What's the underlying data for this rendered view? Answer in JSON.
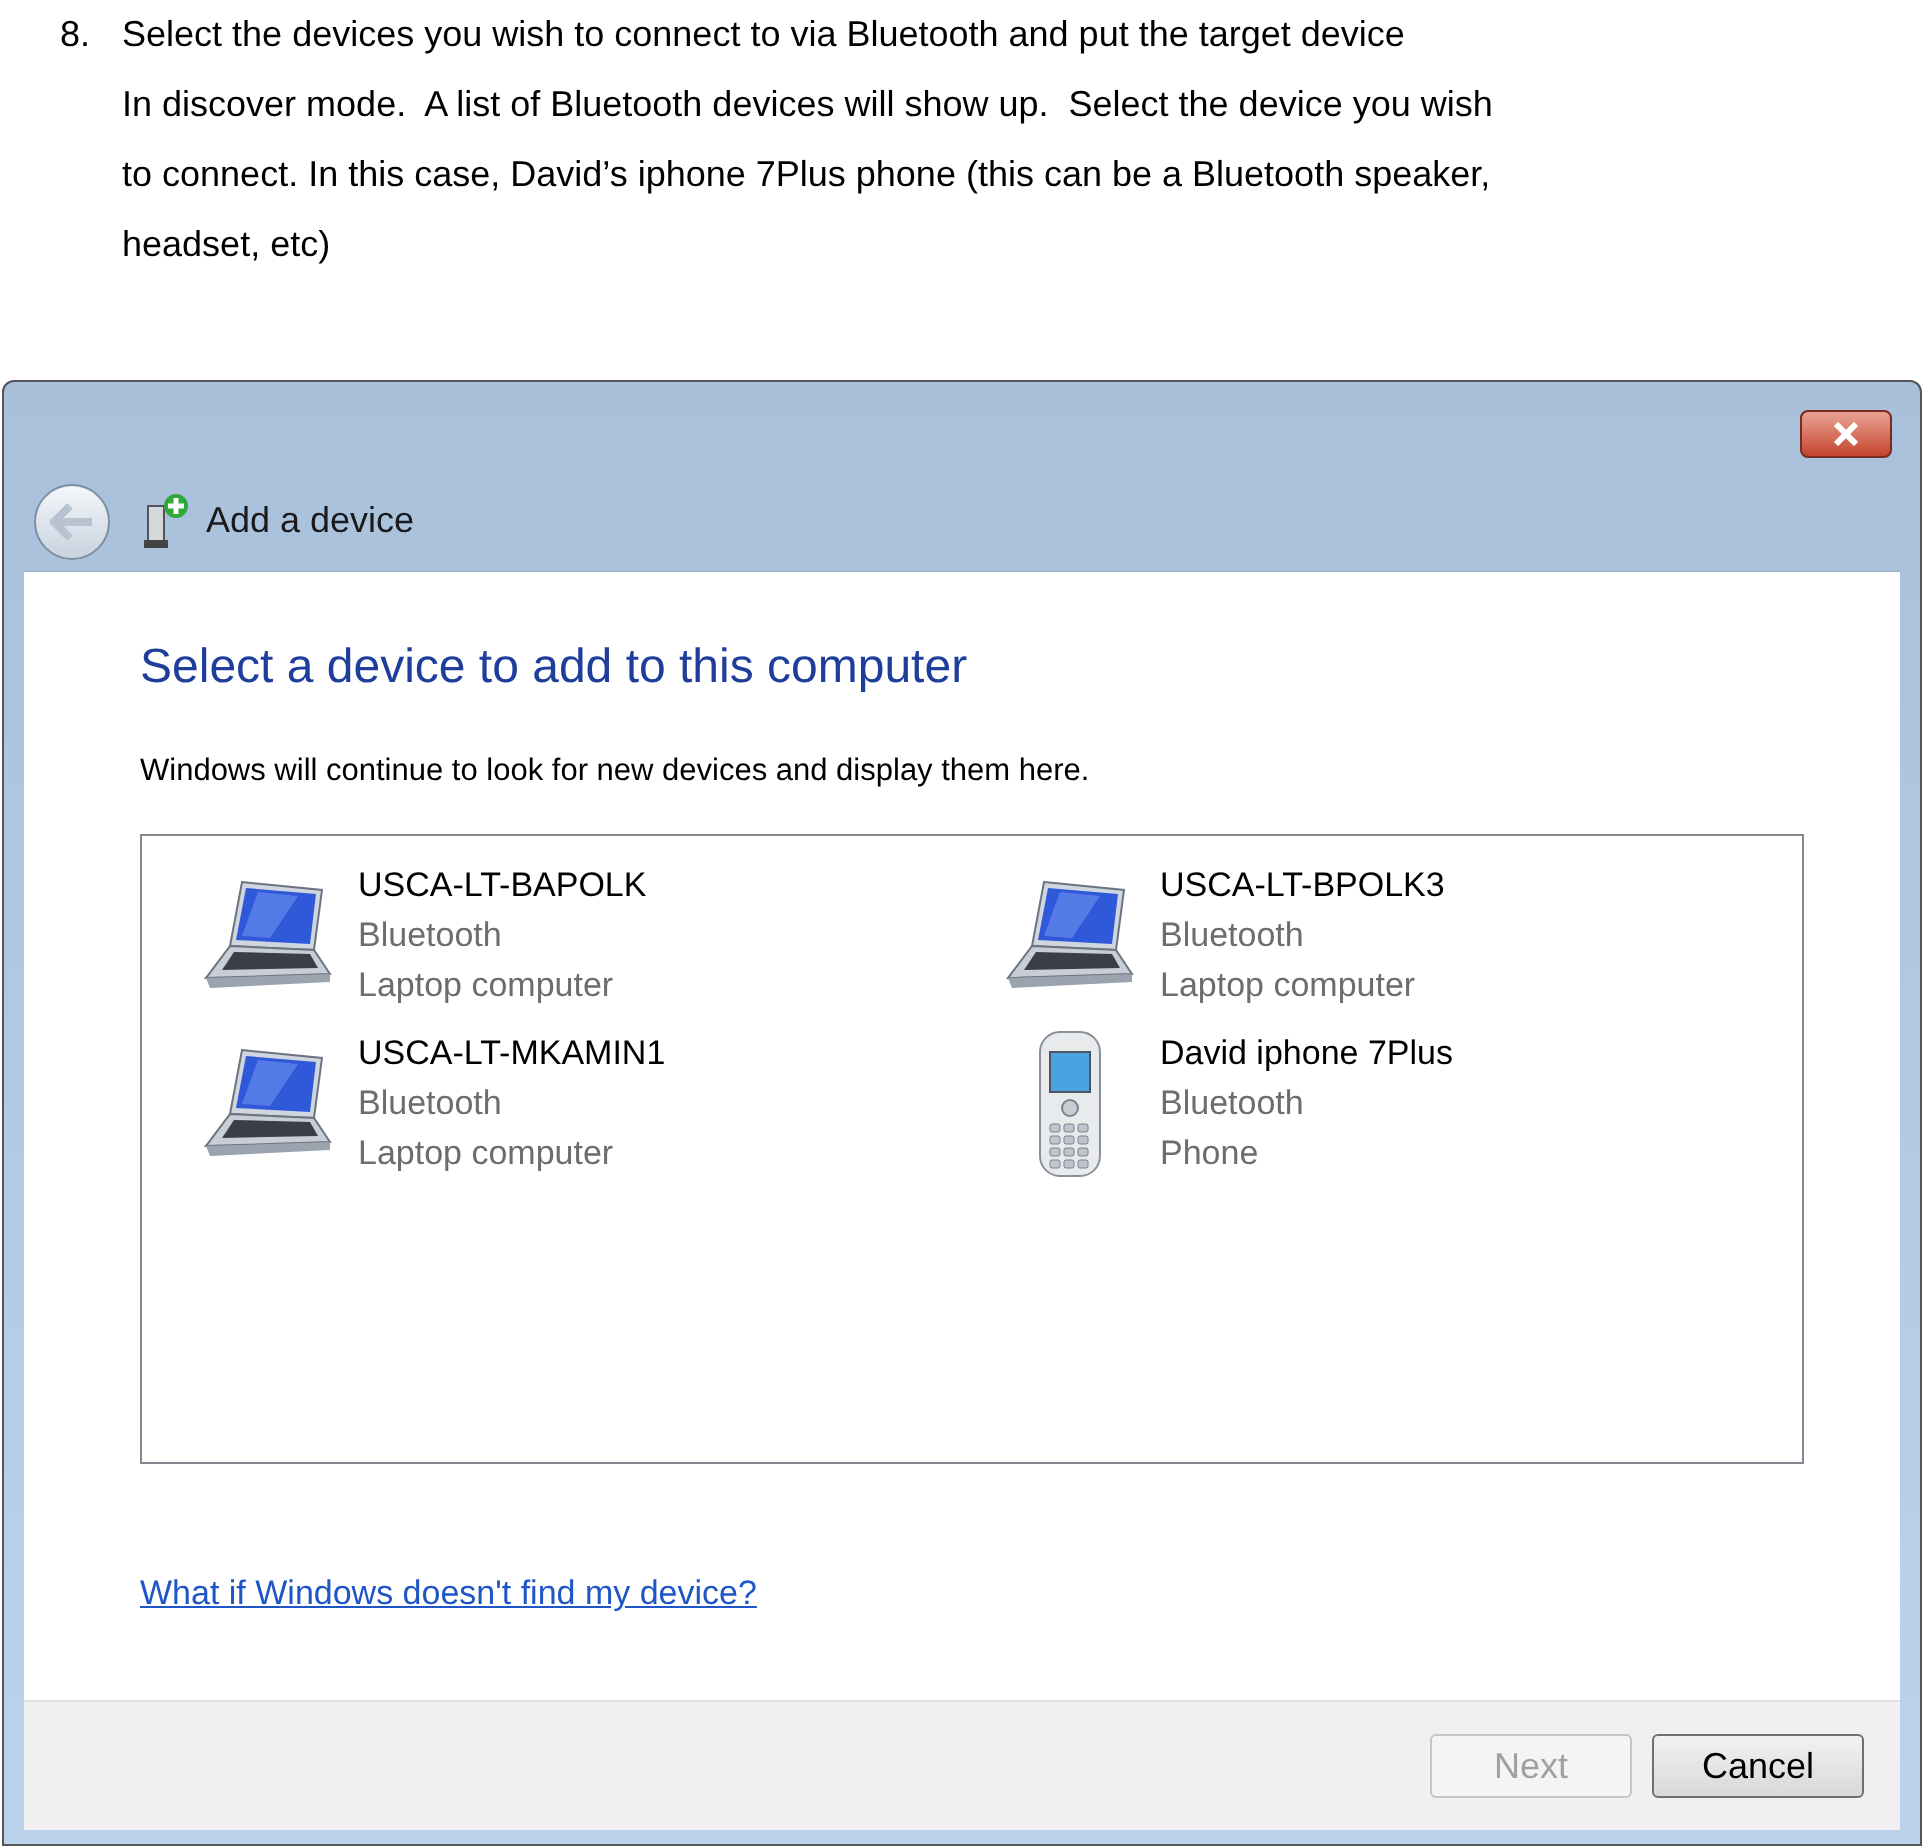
{
  "instruction": {
    "number": "8.",
    "lines": [
      "Select the devices you wish to connect to via Bluetooth and put the target device",
      "In discover mode.  A list of Bluetooth devices will show up.  Select the device you wish",
      "to connect. In this case, David’s iphone 7Plus phone (this can be a Bluetooth speaker,",
      "headset, etc)"
    ]
  },
  "window": {
    "title": "Add a device"
  },
  "heading": "Select a device to add to this computer",
  "description": "Windows will continue to look for new devices and display them here.",
  "devices": [
    {
      "name": "USCA-LT-BAPOLK",
      "connection": "Bluetooth",
      "type": "Laptop computer",
      "kind": "laptop"
    },
    {
      "name": "USCA-LT-BPOLK3",
      "connection": "Bluetooth",
      "type": "Laptop computer",
      "kind": "laptop"
    },
    {
      "name": "USCA-LT-MKAMIN1",
      "connection": "Bluetooth",
      "type": "Laptop computer",
      "kind": "laptop"
    },
    {
      "name": "David iphone 7Plus",
      "connection": "Bluetooth",
      "type": "Phone",
      "kind": "phone"
    }
  ],
  "help_link": "What if Windows doesn't find my device?",
  "buttons": [
    {
      "label": "Next",
      "disabled": true
    },
    {
      "label": "Cancel",
      "disabled": false
    }
  ]
}
